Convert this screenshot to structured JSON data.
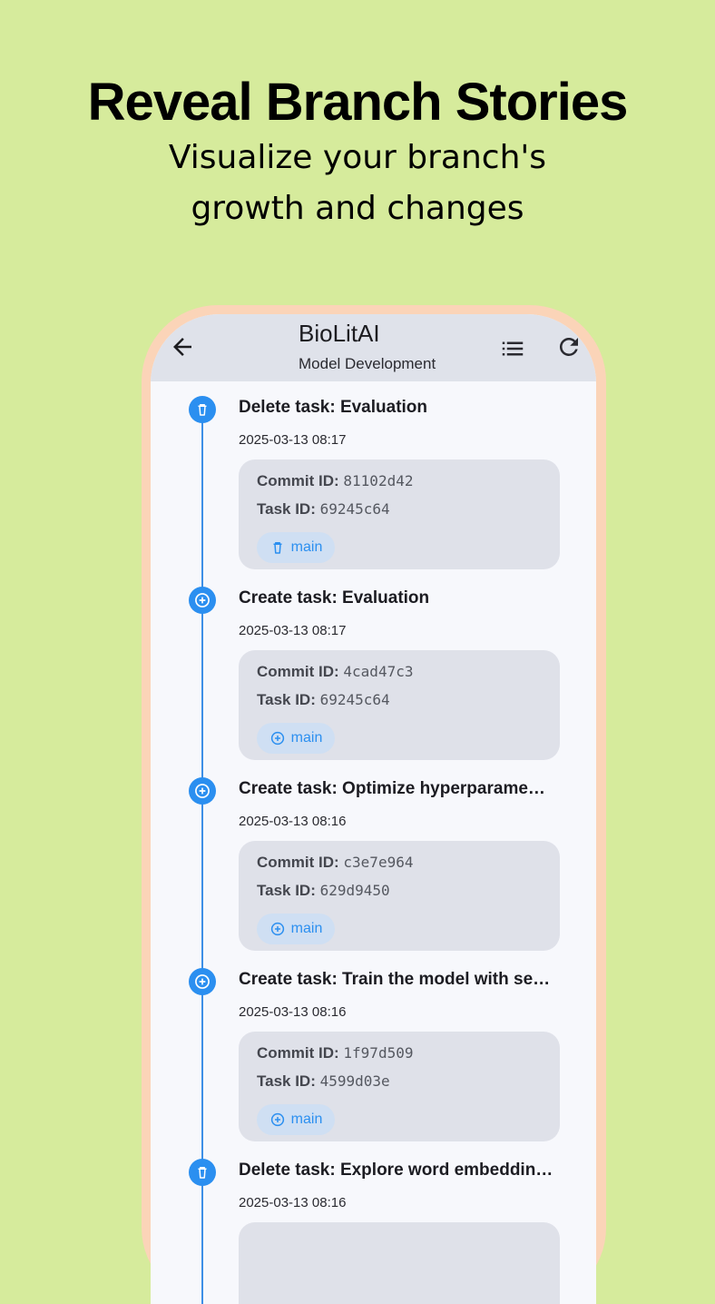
{
  "hero": {
    "title": "Reveal Branch Stories",
    "subtitle_line1": "Visualize your branch's",
    "subtitle_line2": "growth and changes"
  },
  "appbar": {
    "title": "BioLitAI",
    "subtitle": "Model Development",
    "icons": [
      "arrow-left-icon",
      "list-icon",
      "refresh-icon"
    ]
  },
  "commits": [
    {
      "action": "delete",
      "icon": "trash-icon",
      "title": "Delete task: Evaluation",
      "time": "2025-03-13 08:17",
      "commit_label": "Commit ID:",
      "commit_id": "81102d42",
      "task_label": "Task ID:",
      "task_id": "69245c64",
      "branch": "main"
    },
    {
      "action": "create",
      "icon": "plus-circle-icon",
      "title": "Create task: Evaluation",
      "time": "2025-03-13 08:17",
      "commit_label": "Commit ID:",
      "commit_id": "4cad47c3",
      "task_label": "Task ID:",
      "task_id": "69245c64",
      "branch": "main"
    },
    {
      "action": "create",
      "icon": "plus-circle-icon",
      "title": "Create task: Optimize hyperparame…",
      "time": "2025-03-13 08:16",
      "commit_label": "Commit ID:",
      "commit_id": "c3e7e964",
      "task_label": "Task ID:",
      "task_id": "629d9450",
      "branch": "main"
    },
    {
      "action": "create",
      "icon": "plus-circle-icon",
      "title": "Create task: Train the model with se…",
      "time": "2025-03-13 08:16",
      "commit_label": "Commit ID:",
      "commit_id": "1f97d509",
      "task_label": "Task ID:",
      "task_id": "4599d03e",
      "branch": "main"
    },
    {
      "action": "delete",
      "icon": "trash-icon",
      "title": "Delete task: Explore word embeddin…",
      "time": "2025-03-13 08:16"
    }
  ],
  "colors": {
    "background": "#d6eb9c",
    "phone_frame": "#fbd4b8",
    "accent": "#2b8ff0",
    "appbar": "#dfe2ea",
    "card": "#dfe1e9"
  }
}
